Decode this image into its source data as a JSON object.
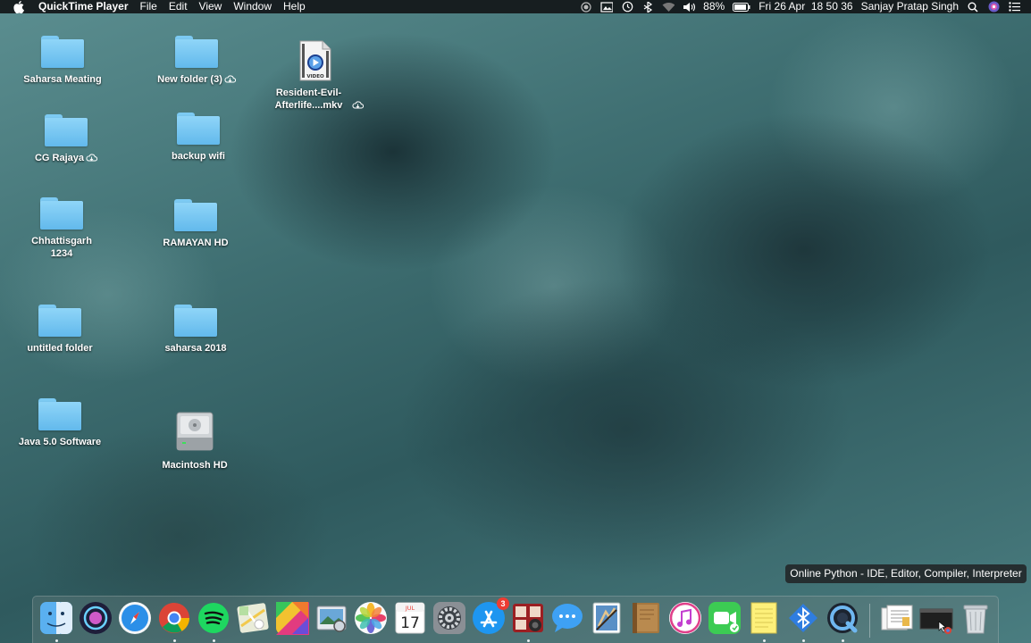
{
  "menubar": {
    "app_name": "QuickTime Player",
    "menus": [
      "File",
      "Edit",
      "View",
      "Window",
      "Help"
    ],
    "battery": "88%",
    "datetime": "Fri 26 Apr  18 50 36",
    "user": "Sanjay Pratap Singh"
  },
  "desktop": {
    "items": [
      {
        "label": "Saharsa Meating",
        "type": "folder"
      },
      {
        "label": "New folder (3)",
        "type": "folder",
        "icloud": true
      },
      {
        "label": "Resident-Evil-Afterlife....mkv",
        "type": "video",
        "icloud": true
      },
      {
        "label": "CG Rajaya",
        "type": "folder",
        "icloud": true
      },
      {
        "label": "backup wifi",
        "type": "folder"
      },
      {
        "label": "Chhattisgarh 1234",
        "type": "folder"
      },
      {
        "label": "RAMAYAN HD",
        "type": "folder"
      },
      {
        "label": "untitled folder",
        "type": "folder"
      },
      {
        "label": "saharsa 2018",
        "type": "folder"
      },
      {
        "label": "Java 5.0 Software",
        "type": "folder"
      },
      {
        "label": "Macintosh HD",
        "type": "drive"
      }
    ],
    "video_badge": "VIDEO"
  },
  "tooltip": "Online Python - IDE, Editor, Compiler, Interpreter",
  "dock": {
    "calendar": {
      "month": "JUL",
      "day": "17"
    },
    "app_store_badge": "3",
    "apps": [
      "finder-icon",
      "siri-icon",
      "safari-icon",
      "chrome-icon",
      "spotify-icon",
      "maps-icon",
      "photo-booth-icon",
      "preview-icon",
      "photos-icon",
      "calendar-icon",
      "system-preferences-icon",
      "app-store-icon",
      "photo-booth-2-icon",
      "messages-icon",
      "preview-2-icon",
      "notes-book-icon",
      "itunes-icon",
      "facetime-icon",
      "stickies-icon",
      "bluetooth-icon",
      "quicktime-icon",
      "documents-icon",
      "chrome-window-icon",
      "trash-icon"
    ]
  },
  "colors": {
    "menubar": "#121618",
    "folder": "#7ccaf3",
    "badge": "#ee3c32"
  }
}
